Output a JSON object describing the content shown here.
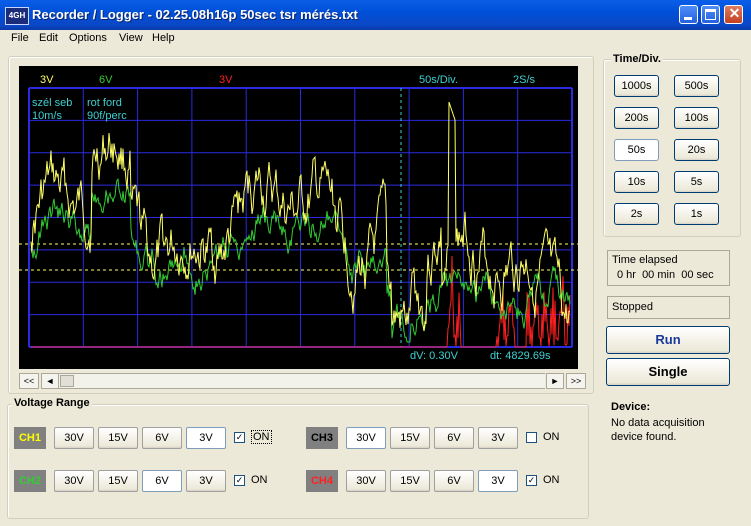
{
  "window": {
    "icon_text": "4GH",
    "title": "Recorder / Logger - 02.25.08h16p 50sec tsr mérés.txt"
  },
  "menu": [
    "File",
    "Edit",
    "Options",
    "View",
    "Help"
  ],
  "scope": {
    "ch1_range": "3V",
    "ch2_range": "6V",
    "ch4_range": "3V",
    "time_div": "50s/Div.",
    "sample_rate": "2S/s",
    "ch1_name": "szél seb",
    "ch1_unit": "10m/s",
    "ch2_name": "rot ford",
    "ch2_unit": "90f/perc",
    "dv": "dV: 0.30V",
    "dt": "dt: 4829.69s",
    "colors": {
      "ch1": "#ffff66",
      "ch2": "#33cc33",
      "ch4": "#ff2020",
      "grid": "#2a2ae0",
      "cursor": "#ffff66",
      "marker": "#40d0d0"
    }
  },
  "scrollbar": {
    "left_fast": "<<",
    "left": "◄",
    "right": "►",
    "right_fast": ">>"
  },
  "timediv": {
    "label": "Time/Div.",
    "buttons": [
      "1000s",
      "500s",
      "200s",
      "100s",
      "50s",
      "20s",
      "10s",
      "5s",
      "2s",
      "1s"
    ],
    "selected": "50s"
  },
  "status": {
    "time_elapsed_label": "Time elapsed",
    "time_elapsed_value": "0 hr  00 min  00 sec",
    "state": "Stopped"
  },
  "controls": {
    "run": "Run",
    "single": "Single"
  },
  "device": {
    "label": "Device:",
    "message": "No data acquisition device found."
  },
  "voltage": {
    "label": "Voltage Range",
    "ranges": [
      "30V",
      "15V",
      "6V",
      "3V"
    ],
    "on_label": "ON",
    "channels": [
      {
        "name": "CH1",
        "selected": "3V",
        "on": true,
        "color": "#ffff00",
        "bg": "#808080"
      },
      {
        "name": "CH2",
        "selected": "6V",
        "on": true,
        "color": "#33cc33",
        "bg": "#808080"
      },
      {
        "name": "CH3",
        "selected": "30V",
        "on": false,
        "color": "#000000",
        "bg": "#808080"
      },
      {
        "name": "CH4",
        "selected": "3V",
        "on": true,
        "color": "#ff2020",
        "bg": "#808080"
      }
    ]
  }
}
